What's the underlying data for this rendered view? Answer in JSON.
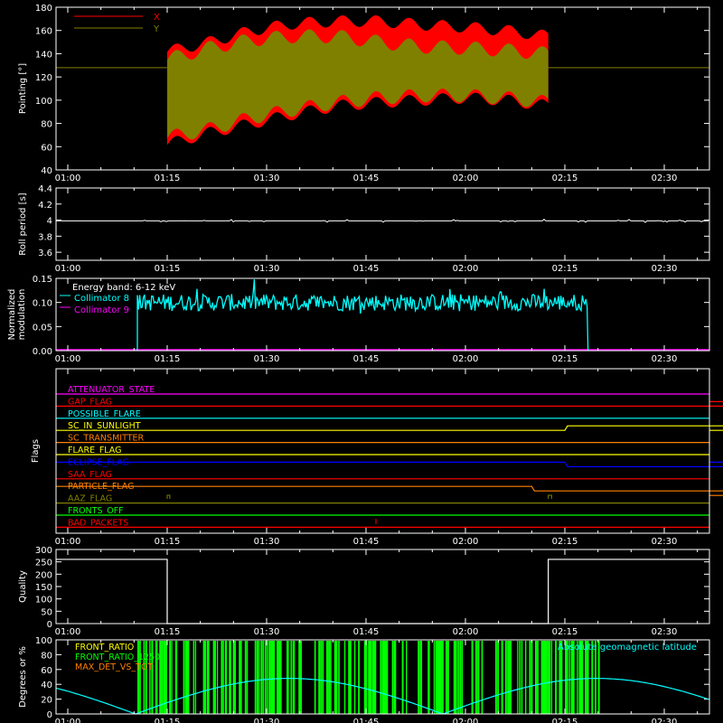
{
  "chart_data": [
    {
      "type": "line",
      "ylabel": "Pointing [°]",
      "ylim": [
        40,
        180
      ],
      "yticks": [
        40,
        60,
        80,
        100,
        120,
        140,
        160,
        180
      ],
      "xlim_min": [
        60,
        160
      ],
      "series": [
        {
          "name": "X",
          "color": "#ff0000",
          "baseline": 128,
          "band_x": [
            75,
            80,
            90,
            100,
            110,
            120,
            130,
            140,
            150,
            155
          ],
          "band_lo": [
            62,
            72,
            80,
            88,
            95,
            98,
            100,
            102,
            100,
            95
          ],
          "band_hi": [
            142,
            150,
            160,
            166,
            168,
            168,
            165,
            163,
            160,
            155
          ]
        },
        {
          "name": "Y",
          "color": "#808000",
          "baseline": 128,
          "band_x": [
            75,
            80,
            90,
            100,
            110,
            120,
            130,
            140,
            150,
            155
          ],
          "band_lo": [
            68,
            75,
            85,
            92,
            98,
            102,
            104,
            104,
            102,
            98
          ],
          "band_hi": [
            135,
            145,
            152,
            155,
            155,
            150,
            146,
            145,
            143,
            140
          ]
        }
      ]
    },
    {
      "type": "line",
      "ylabel": "Roll period [s]",
      "ylim": [
        3.5,
        4.4
      ],
      "yticks": [
        3.6,
        3.8,
        4.0,
        4.2,
        4.4
      ],
      "series": [
        {
          "name": "",
          "color": "#ffffff",
          "value": 3.99
        }
      ]
    },
    {
      "type": "line",
      "ylabel": "Normalized modulation",
      "ylabel_lines": [
        "Normalized",
        "modulation"
      ],
      "ylim": [
        0,
        0.15
      ],
      "yticks": [
        0.0,
        0.05,
        0.1,
        0.15
      ],
      "annotation": "Energy band: 6-12 keV",
      "start_min": 70,
      "end_min": 137,
      "mean": 0.1,
      "series": [
        {
          "name": "Collimator 8",
          "color": "#00ffff"
        },
        {
          "name": "Collimator 9",
          "color": "#ff00ff"
        }
      ]
    },
    {
      "type": "line",
      "ylabel": "Flags",
      "flags": [
        {
          "name": "ATTENUATOR_STATE",
          "color": "#ff00ff",
          "steps": []
        },
        {
          "name": "GAP_FLAG",
          "color": "#ff0000",
          "steps": [
            [
              137,
              1
            ]
          ]
        },
        {
          "name": "POSSIBLE_FLARE",
          "color": "#00ffff",
          "steps": []
        },
        {
          "name": "SC_IN_SUNLIGHT",
          "color": "#ffff00",
          "steps": [
            [
              75,
              1
            ],
            [
              135,
              0
            ]
          ]
        },
        {
          "name": "SC_TRANSMITTER",
          "color": "#ff8000",
          "steps": []
        },
        {
          "name": "FLARE_FLAG",
          "color": "#ffff00",
          "steps": []
        },
        {
          "name": "ECLIPSE_FLAG",
          "color": "#0000ff",
          "steps": [
            [
              75,
              0
            ],
            [
              135,
              1
            ]
          ]
        },
        {
          "name": "SAA_FLAG",
          "color": "#ff0000",
          "steps": []
        },
        {
          "name": "PARTICLE_FLAG",
          "color": "#ff8000",
          "steps": [
            [
              70,
              0
            ],
            [
              148,
              -1
            ]
          ]
        },
        {
          "name": "AAZ_FLAG",
          "color": "#808000",
          "steps": []
        },
        {
          "name": "FRONTS_OFF",
          "color": "#00ff00",
          "steps": []
        },
        {
          "name": "BAD_PACKETS",
          "color": "#ff0000",
          "steps": []
        }
      ]
    },
    {
      "type": "line",
      "ylabel": "Quality",
      "ylim": [
        0,
        300
      ],
      "yticks": [
        0,
        50,
        100,
        150,
        200,
        250,
        300
      ],
      "series": [
        {
          "name": "",
          "color": "#ffffff",
          "x": [
            0,
            75,
            75,
            135,
            135,
            160
          ],
          "y": [
            260,
            260,
            0,
            0,
            260,
            260
          ]
        }
      ]
    },
    {
      "type": "line",
      "ylabel": "Degrees or %",
      "ylim": [
        0,
        100
      ],
      "yticks": [
        0,
        20,
        40,
        60,
        80,
        100
      ],
      "annotation": "Absolute geomagnetic latitude",
      "series": [
        {
          "name": "FRONT_RATIO",
          "color": "#ffff00"
        },
        {
          "name": "FRONT_RATIO_1250",
          "color": "#00ff00"
        },
        {
          "name": "MAX_DET_VS_TOT",
          "color": "#ff8000"
        },
        {
          "name": "",
          "color": "#00ffff"
        }
      ]
    }
  ],
  "x_axis": {
    "xlim_min": [
      0,
      160
    ],
    "ticks": [
      {
        "min": 0,
        "label": "01:00"
      },
      {
        "min": 15,
        "label": "01:15"
      },
      {
        "min": 30,
        "label": "01:30"
      },
      {
        "min": 45,
        "label": "01:45"
      },
      {
        "min": 60,
        "label": "02:00"
      },
      {
        "min": 75,
        "label": "02:15"
      },
      {
        "min": 90,
        "label": "02:30"
      }
    ]
  },
  "legend_pointing": [
    "X",
    "Y"
  ]
}
